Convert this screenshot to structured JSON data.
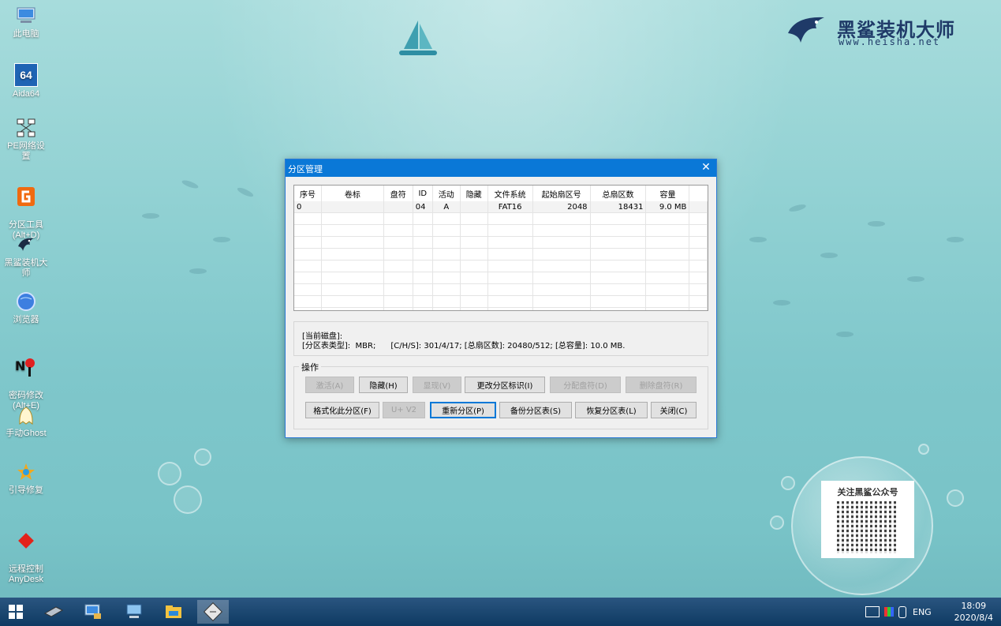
{
  "desktop": {
    "icons": [
      {
        "label": "此电脑"
      },
      {
        "label": "Aida64",
        "glyph": "64"
      },
      {
        "label": "PE网络设置"
      },
      {
        "label": "分区工具\n(Alt+D)"
      },
      {
        "label": "黑鲨装机大师"
      },
      {
        "label": "浏览器"
      },
      {
        "label": "密码修改\n(Alt+E)"
      },
      {
        "label": "手动Ghost"
      },
      {
        "label": "引导修复"
      },
      {
        "label": "远程控制\nAnyDesk"
      }
    ],
    "logo": {
      "name": "黑鲨装机大师",
      "url": "www.heisha.net"
    },
    "qr_card": {
      "title": "关注黑鲨公众号"
    }
  },
  "dialog": {
    "title": "分区管理",
    "close_glyph": "✕",
    "columns": [
      "序号",
      "卷标",
      "盘符",
      "ID",
      "活动",
      "隐藏",
      "文件系统",
      "起始扇区号",
      "总扇区数",
      "容量"
    ],
    "rows": [
      [
        "0",
        "",
        "",
        "04",
        "A",
        "",
        "FAT16",
        "2048",
        "18431",
        "9.0 MB"
      ]
    ],
    "info": {
      "line1": "[当前磁盘]:",
      "line2": "[分区表类型]:  MBR;      [C/H/S]: 301/4/17; [总扇区数]: 20480/512; [总容量]: 10.0 MB."
    },
    "operations": {
      "legend": "操作",
      "buttons": {
        "activate": "激活(A)",
        "hide": "隐藏(H)",
        "show": "显现(V)",
        "change_id": "更改分区标识(I)",
        "assign_letter": "分配盘符(D)",
        "remove_letter": "删除盘符(R)",
        "format": "格式化此分区(F)",
        "u_v2": "U+ V2",
        "repartition": "重新分区(P)",
        "backup_table": "备份分区表(S)",
        "restore_table": "恢复分区表(L)",
        "close": "关闭(C)"
      }
    }
  },
  "taskbar": {
    "tray_lang": "ENG",
    "time": "18:09",
    "date": "2020/8/4"
  },
  "colors": {
    "titlebar": "#0a78d7",
    "taskbar": "#0e3a62",
    "accent": "#0078d7"
  }
}
